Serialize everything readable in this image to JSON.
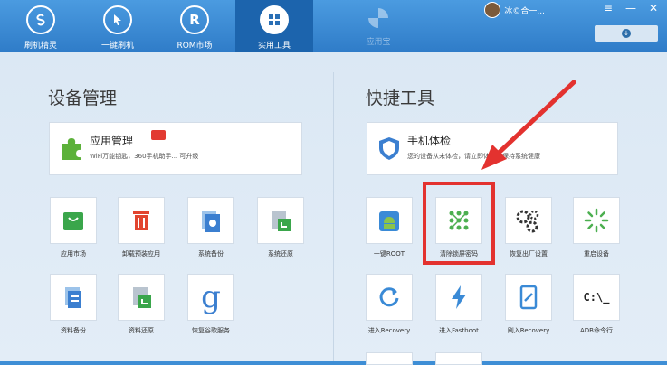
{
  "nav": [
    {
      "label": "刷机精灵",
      "icon": "brand-s-icon"
    },
    {
      "label": "一键刷机",
      "icon": "cursor-icon"
    },
    {
      "label": "ROM市场",
      "icon": "r-circle-icon"
    },
    {
      "label": "实用工具",
      "icon": "grid-icon",
      "active": true
    },
    {
      "label": "应用宝",
      "icon": "app-store-icon",
      "faded": true
    }
  ],
  "user": {
    "name": "冰©合一..."
  },
  "window_controls": [
    "≡",
    "—",
    "✕"
  ],
  "left_panel": {
    "title": "设备管理",
    "feature": {
      "title": "应用管理",
      "subtitle": "WiFi万能钥匙，360手机助手... 可升级",
      "icon": "puzzle-icon"
    },
    "tiles": [
      {
        "label": "应用市场",
        "icon": "shopping-bag-icon",
        "color": "#3aa64b"
      },
      {
        "label": "卸载预装应用",
        "icon": "trash-icon",
        "color": "#e2452f"
      },
      {
        "label": "系统备份",
        "icon": "system-backup-icon",
        "color": "#3b7fd0"
      },
      {
        "label": "系统还原",
        "icon": "system-restore-icon",
        "color": "#3aa64b"
      },
      {
        "label": "资料备份",
        "icon": "data-backup-icon",
        "color": "#3b7fd0"
      },
      {
        "label": "资料还原",
        "icon": "data-restore-icon",
        "color": "#3aa64b"
      },
      {
        "label": "恢复谷歌服务",
        "icon": "google-g-icon",
        "color": "#3b7fd0"
      }
    ]
  },
  "right_panel": {
    "title": "快捷工具",
    "feature": {
      "title": "手机体检",
      "subtitle": "您的设备从未体检，请立即体检，保持系统健康",
      "icon": "shield-icon"
    },
    "tiles": [
      {
        "label": "一键ROOT",
        "icon": "android-icon",
        "color": "#3a8ad6"
      },
      {
        "label": "清除锁屏密码",
        "icon": "pattern-lock-icon",
        "color": "#4caf50"
      },
      {
        "label": "恢复出厂设置",
        "icon": "gears-icon",
        "color": "#333333"
      },
      {
        "label": "重启设备",
        "icon": "spinner-icon",
        "color": "#4caf50"
      },
      {
        "label": "进入Recovery",
        "icon": "refresh-icon",
        "color": "#3a8ad6"
      },
      {
        "label": "进入Fastboot",
        "icon": "lightning-icon",
        "color": "#3a8ad6"
      },
      {
        "label": "刷入Recovery",
        "icon": "phone-edit-icon",
        "color": "#3a8ad6"
      },
      {
        "label": "ADB命令行",
        "icon": "terminal-icon",
        "color": "#222222",
        "text": "C:\\_"
      }
    ]
  },
  "colors": {
    "highlight": "#e3322f",
    "topbar": "#2f7cc8"
  }
}
